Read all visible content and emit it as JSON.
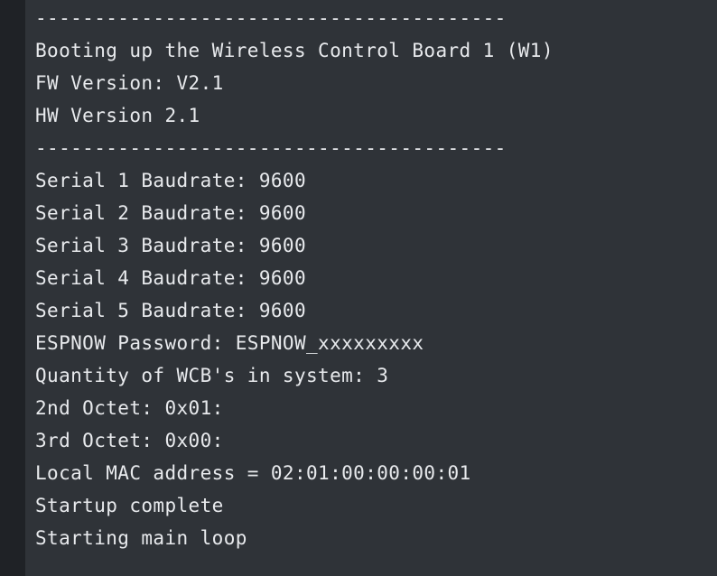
{
  "console": {
    "lines": [
      "----------------------------------------",
      "Booting up the Wireless Control Board 1 (W1)",
      "FW Version: V2.1",
      "HW Version 2.1",
      "----------------------------------------",
      "Serial 1 Baudrate: 9600",
      "Serial 2 Baudrate: 9600",
      "Serial 3 Baudrate: 9600",
      "Serial 4 Baudrate: 9600",
      "Serial 5 Baudrate: 9600",
      "ESPNOW Password: ESPNOW_xxxxxxxxx",
      "Quantity of WCB's in system: 3",
      "2nd Octet: 0x01:",
      "3rd Octet: 0x00:",
      "Local MAC address = 02:01:00:00:00:01",
      "Startup complete",
      "Starting main loop"
    ]
  },
  "colors": {
    "background": "#2f3338",
    "gutter": "#1f2226",
    "text": "#e8eaed"
  }
}
